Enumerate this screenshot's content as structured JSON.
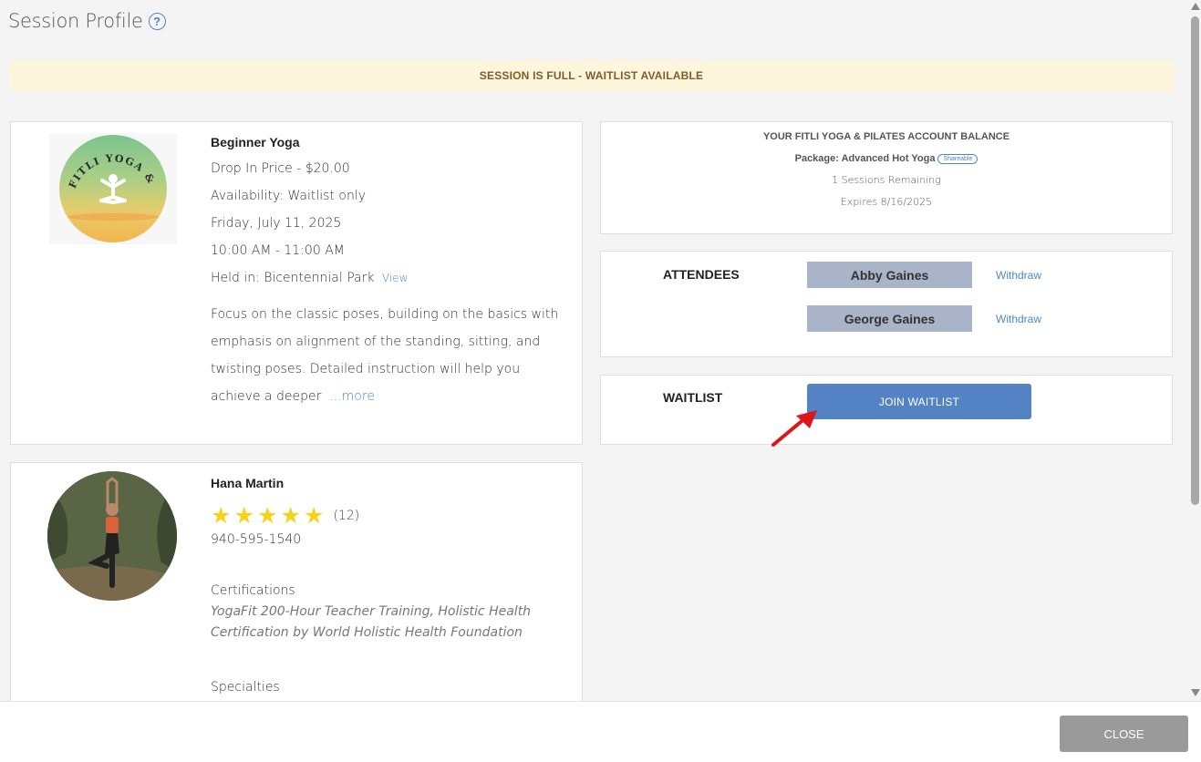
{
  "header": {
    "title": "Session Profile",
    "help_icon": "?"
  },
  "banner": {
    "text": "SESSION IS FULL - WAITLIST AVAILABLE"
  },
  "session": {
    "logo_icon": "yoga-logo-icon",
    "name": "Beginner Yoga",
    "price": "Drop In Price - $20.00",
    "availability": "Availability: Waitlist only",
    "date": "Friday, July 11, 2025",
    "time": "10:00 AM - 11:00 AM",
    "location": "Held in: Bicentennial Park",
    "location_link": "View",
    "description": "Focus on the classic poses, building on the basics with emphasis on alignment of the standing, sitting, and twisting poses. Detailed instruction will help you achieve a deeper",
    "more_link": "...more"
  },
  "instructor": {
    "name": "Hana Martin",
    "rating": 5,
    "stars": [
      "★",
      "★",
      "★",
      "★",
      "★"
    ],
    "review_count": "(12)",
    "phone": "940-595-1540",
    "certifications_label": "Certifications",
    "certifications": "YogaFit 200-Hour Teacher Training, Holistic Health Certification by World Holistic Health Foundation",
    "specialties_label": "Specialties"
  },
  "balance": {
    "title": "YOUR FITLI YOGA & PILATES ACCOUNT BALANCE",
    "package": "Package: Advanced Hot Yoga",
    "shareable": "Shareable",
    "sessions_remaining": "1 Sessions Remaining",
    "expires": "Expires 8/16/2025"
  },
  "attendees": {
    "label": "ATTENDEES",
    "people": [
      {
        "name": "Abby Gaines",
        "action": "Withdraw"
      },
      {
        "name": "George Gaines",
        "action": "Withdraw"
      }
    ]
  },
  "waitlist": {
    "label": "WAITLIST",
    "button": "JOIN WAITLIST"
  },
  "footer": {
    "close": "CLOSE"
  },
  "colors": {
    "accent": "#5383c4",
    "link": "#4f86c6",
    "banner_bg": "#fdf5dc",
    "banner_text": "#7d5e28",
    "star": "#f5d31c",
    "attendee_bg": "#a9b4c8",
    "arrow": "#e0141b"
  }
}
